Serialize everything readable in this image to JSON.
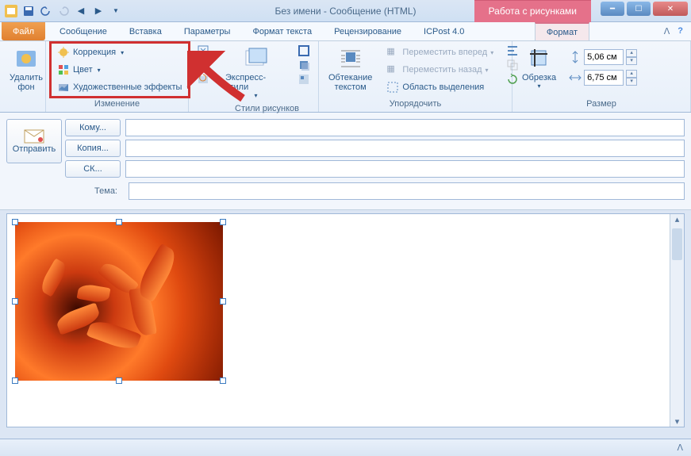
{
  "window": {
    "title": "Без имени  -  Сообщение (HTML)",
    "contextual_tab": "Работа с рисунками"
  },
  "tabs": {
    "file": "Файл",
    "message": "Сообщение",
    "insert": "Вставка",
    "options": "Параметры",
    "format_text": "Формат текста",
    "review": "Рецензирование",
    "icpost": "ICPost 4.0",
    "format": "Формат"
  },
  "ribbon": {
    "remove_bg": "Удалить\nфон",
    "adjust": {
      "corrections": "Коррекция",
      "color": "Цвет",
      "artistic": "Художественные эффекты",
      "label": "Изменение"
    },
    "styles": {
      "quick": "Экспресс-стили",
      "label": "Стили рисунков"
    },
    "arrange": {
      "wrap": "Обтекание\nтекстом",
      "forward": "Переместить вперед",
      "backward": "Переместить назад",
      "selection": "Область выделения",
      "label": "Упорядочить"
    },
    "size": {
      "crop": "Обрезка",
      "height": "5,06 см",
      "width": "6,75 см",
      "label": "Размер"
    }
  },
  "compose": {
    "send": "Отправить",
    "to": "Кому...",
    "cc": "Копия...",
    "bcc": "СК...",
    "subject_label": "Тема:",
    "to_val": "",
    "cc_val": "",
    "bcc_val": "",
    "subject_val": ""
  }
}
